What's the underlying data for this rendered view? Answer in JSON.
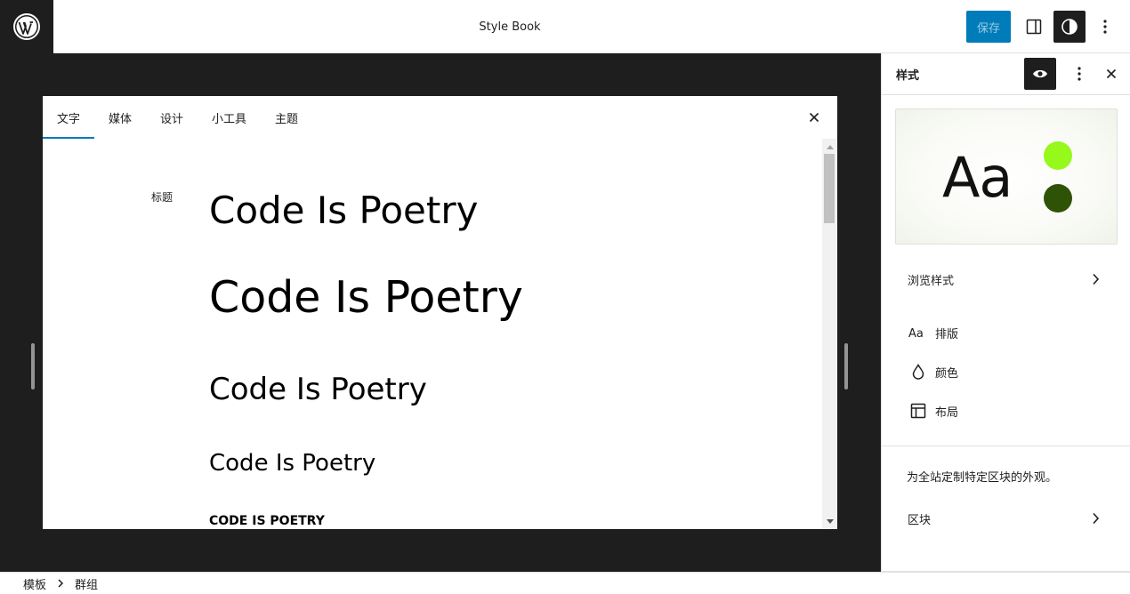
{
  "header": {
    "logo_icon": "wordpress-logo-icon",
    "title": "Style Book",
    "save_label": "保存",
    "buttons": [
      "sidebar-toggle-icon",
      "styles-half-circle-icon",
      "more-vertical-icon"
    ]
  },
  "stylebook": {
    "tabs": [
      {
        "label": "文字",
        "active": true
      },
      {
        "label": "媒体",
        "active": false
      },
      {
        "label": "设计",
        "active": false
      },
      {
        "label": "小工具",
        "active": false
      },
      {
        "label": "主题",
        "active": false
      }
    ],
    "section_label": "标题",
    "samples": [
      "Code Is Poetry",
      "Code Is Poetry",
      "Code Is Poetry",
      "Code Is Poetry",
      "CODE IS POETRY"
    ]
  },
  "sidebar": {
    "title": "样式",
    "preview": {
      "sample_text": "Aa",
      "colors": [
        "#97f81c",
        "#2f5306"
      ]
    },
    "browse_label": "浏览样式",
    "menu": [
      {
        "label": "排版",
        "icon": "typography-aa-icon"
      },
      {
        "label": "颜色",
        "icon": "droplet-icon"
      },
      {
        "label": "布局",
        "icon": "layout-icon"
      }
    ],
    "blocks_description": "为全站定制特定区块的外观。",
    "blocks_label": "区块"
  },
  "breadcrumb": [
    "模板",
    "群组"
  ],
  "colors": {
    "accent": "#007cba",
    "dark": "#1e1e1e"
  }
}
